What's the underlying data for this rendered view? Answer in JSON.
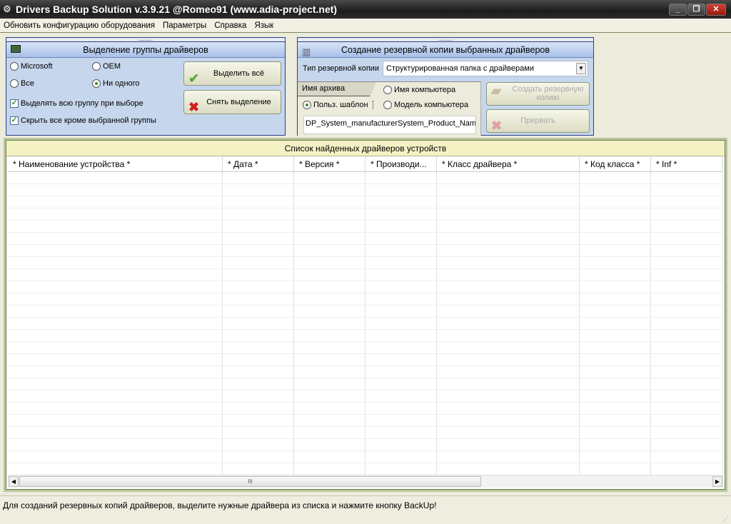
{
  "window": {
    "title": "Drivers Backup Solution v.3.9.21 @Romeo91 (www.adia-project.net)",
    "minimize": "_",
    "restore": "❐",
    "close": "✕"
  },
  "menu": [
    "Обновить конфигурацию оборудования",
    "Параметры",
    "Справка",
    "Язык"
  ],
  "group_panel": {
    "title": "Выделение группы драйверов",
    "radios": [
      {
        "label": "Microsoft",
        "checked": false
      },
      {
        "label": "OEM",
        "checked": false
      },
      {
        "label": "Все",
        "checked": false
      },
      {
        "label": "Ни одного",
        "checked": true
      }
    ],
    "checkboxes": [
      {
        "label": "Выделять всю группу при выборе",
        "checked": true
      },
      {
        "label": "Скрыть все кроме выбранной группы",
        "checked": true
      }
    ],
    "select_all": "Выделить всё",
    "deselect": "Снять выделение"
  },
  "backup_panel": {
    "title": "Создание резервной копии выбранных драйверов",
    "type_label": "Тип резервной копии",
    "type_value": "Структурированная папка с драйверами",
    "archive_tab": "Имя архива",
    "radios": [
      {
        "label": "Имя компьютера",
        "checked": false
      },
      {
        "label": "Польз. шаблон",
        "checked": true
      },
      {
        "label": "Модель компьютера",
        "checked": false
      }
    ],
    "template_value": "DP_System_manufacturerSystem_Product_Name",
    "create_button": "Создать резервную копию",
    "abort_button": "Прервать"
  },
  "list": {
    "title": "Список найденных драйверов устройств",
    "columns": [
      "* Наименование устройства *",
      "* Дата *",
      "* Версия *",
      "* Производи...",
      "* Класс драйвера *",
      "* Код класса *",
      "* Inf *"
    ],
    "scroll_grip": "III"
  },
  "status": "Для созданий резервных копий драйверов, выделите нужные драйвера из списка и нажмите кнопку BackUp!",
  "colors": {
    "panel": "#c6d6ec",
    "list_header": "#f4f2c4",
    "frame": "#b9c79b"
  }
}
